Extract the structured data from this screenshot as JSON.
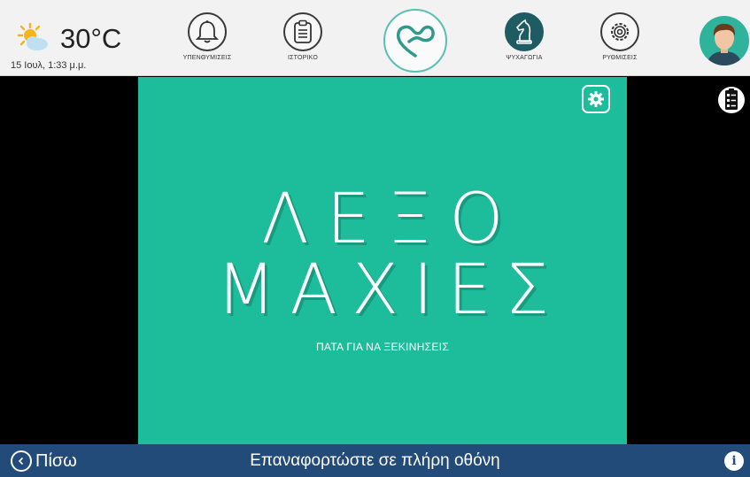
{
  "weather": {
    "temperature": "30°C",
    "datetime": "15 Ιουλ, 1:33 μ.μ.",
    "icon": "partly-sunny-icon"
  },
  "nav": {
    "reminders_label": "ΥΠΕΝΘΥΜΙΣΕΙΣ",
    "history_label": "ΙΣΤΟΡΙΚΟ",
    "entertainment_label": "ΨΥΧΑΓΩΓΙΑ",
    "settings_label": "ΡΥΘΜΙΣΕΙΣ"
  },
  "game": {
    "title_line1": "ΛΕΞΟ",
    "title_line2": "ΜΑΧΙΕΣ",
    "subtitle": "ΠΑΤΑ ΓΙΑ ΝΑ ΞΕΚΙΝΗΣΕΙΣ",
    "background_color": "#1dbc9b"
  },
  "bottombar": {
    "back_label": "Πίσω",
    "reload_label": "Επαναφορτώστε σε πλήρη οθόνη",
    "color": "#234b7a"
  }
}
